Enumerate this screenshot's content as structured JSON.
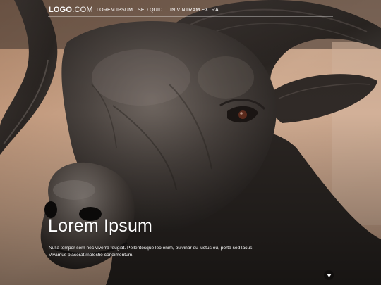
{
  "header": {
    "logo_bold": "LOGO",
    "logo_light": ".COM",
    "nav": [
      {
        "label": "LOREM IPSUM"
      },
      {
        "label": "SED QUID"
      },
      {
        "label": "IN VINTRAM EXTRA"
      }
    ]
  },
  "hero": {
    "title": "Lorem Ipsum",
    "text_line1": "Nulla tempor sem nec viverra feugiat. Pellentesque leo enim, pulvinar eu luctus eu, porta sed lacus.",
    "text_line2": "Vivamus placerat molestie condimentum.",
    "image": "bronze-ram-statue",
    "scroll_icon": "chevron-down-icon"
  },
  "colors": {
    "text": "#ffffff",
    "background": "#2a2623",
    "wall": "#cfa98c"
  }
}
